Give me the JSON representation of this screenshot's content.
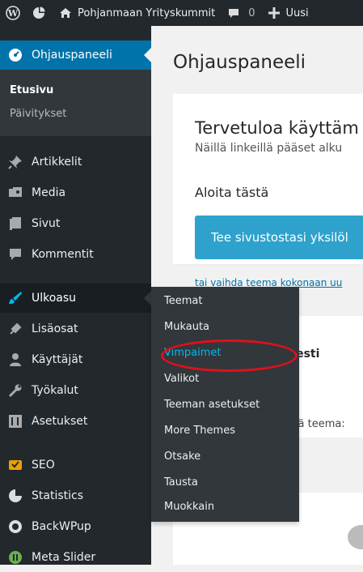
{
  "adminbar": {
    "site_name": "Pohjanmaan Yrityskummit",
    "comments_count": "0",
    "new_label": "Uusi"
  },
  "sidebar": {
    "dashboard_label": "Ohjauspaneeli",
    "dashboard_sub": {
      "home": "Etusivu",
      "updates": "Päivitykset"
    },
    "items": [
      {
        "label": "Artikkelit",
        "icon": "pin-icon"
      },
      {
        "label": "Media",
        "icon": "media-icon"
      },
      {
        "label": "Sivut",
        "icon": "pages-icon"
      },
      {
        "label": "Kommentit",
        "icon": "comments-icon"
      },
      {
        "label": "Ulkoasu",
        "icon": "appearance-icon"
      },
      {
        "label": "Lisäosat",
        "icon": "plugins-icon"
      },
      {
        "label": "Käyttäjät",
        "icon": "users-icon"
      },
      {
        "label": "Työkalut",
        "icon": "tools-icon"
      },
      {
        "label": "Asetukset",
        "icon": "settings-icon"
      },
      {
        "label": "SEO",
        "icon": "seo-icon"
      },
      {
        "label": "Statistics",
        "icon": "statistics-icon"
      },
      {
        "label": "BackWPup",
        "icon": "backwpup-icon"
      },
      {
        "label": "Meta Slider",
        "icon": "metaslider-icon"
      }
    ]
  },
  "flyout": [
    "Teemat",
    "Mukauta",
    "Vimpaimet",
    "Valikot",
    "Teeman asetukset",
    "More Themes",
    "Otsake",
    "Tausta",
    "Muokkain"
  ],
  "content": {
    "page_title": "Ohjauspaneeli",
    "welcome_title": "Tervetuloa käyttäm",
    "welcome_text": "Näillä linkeillä pääset alku",
    "start_title": "Aloita tästä",
    "customize_button": "Tee sivustostasi yksilöl",
    "theme_link": "tai vaihda teema kokonaan uu",
    "activity_title": "hyesti",
    "theme_text": "ossä teema:"
  },
  "colors": {
    "accent": "#0073aa",
    "highlight": "#00b9eb",
    "circle": "#e0101b",
    "sidebar": "#23282d"
  }
}
